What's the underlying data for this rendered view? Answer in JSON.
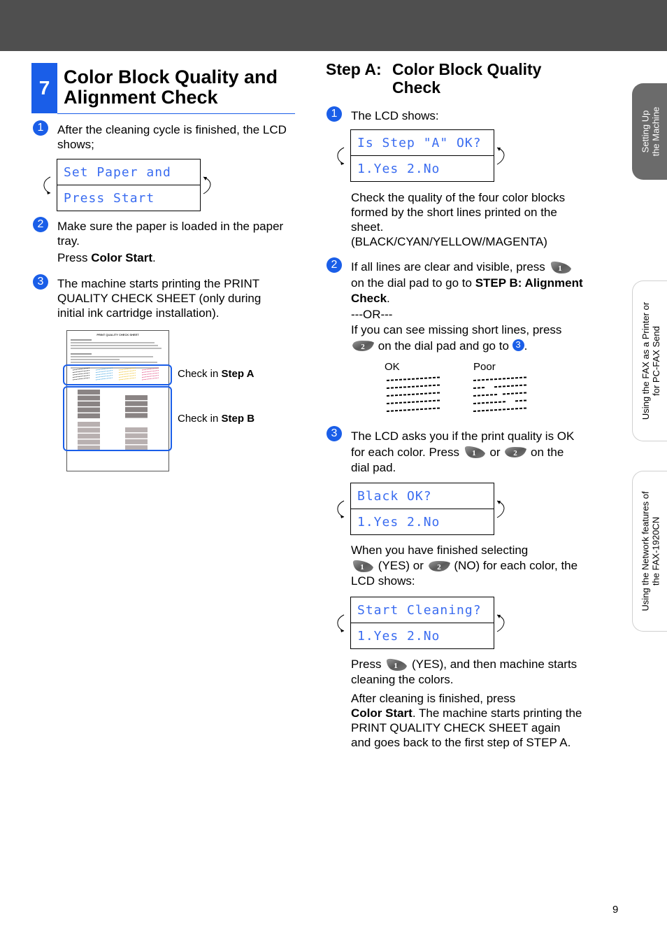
{
  "header": {
    "bar_color": "#4f4f4f"
  },
  "section": {
    "number": "7",
    "title_line1": "Color Block Quality and",
    "title_line2": "Alignment Check",
    "accent": "#1a5ee8"
  },
  "left": {
    "step1": {
      "num": "1",
      "text1": "After the cleaning cycle is finished, the LCD",
      "text2": "shows;"
    },
    "lcd1": {
      "line1": "Set Paper and",
      "line2": "Press Start"
    },
    "step2": {
      "num": "2",
      "text1": "Make sure the paper is loaded in the paper",
      "text2": "tray.",
      "press_prefix": "Press ",
      "press_bold": "Color Start",
      "press_suffix": "."
    },
    "step3": {
      "num": "3",
      "text1": "The machine starts printing the PRINT",
      "text2": "QUALITY CHECK SHEET (only during",
      "text3": "initial ink cartridge installation)."
    },
    "figure": {
      "sheet_title": "PRINT QUALITY CHECK SHEET",
      "label_a_prefix": "Check in ",
      "label_a_bold": "Step A",
      "label_b_prefix": "Check in ",
      "label_b_bold": "Step B",
      "ink_colors": [
        "#222222",
        "#3aa0e0",
        "#f0c020",
        "#e0407a"
      ]
    }
  },
  "right": {
    "heading": {
      "prefix": "Step A:",
      "title_line1": "Color Block Quality",
      "title_line2": "Check"
    },
    "step1": {
      "num": "1",
      "text": "The LCD shows:"
    },
    "lcd1": {
      "line1": "Is Step \"A\" OK?",
      "line2": "1.Yes 2.No"
    },
    "check_text": {
      "line1": "Check the quality of the four color blocks",
      "line2": "formed by the short lines printed on the",
      "line3": "sheet.",
      "line4": "(BLACK/CYAN/YELLOW/MAGENTA)"
    },
    "step2": {
      "num": "2",
      "line1": "If all lines are clear and visible, press",
      "line2_prefix": "on the dial pad to go to ",
      "line2_bold": "STEP B: Alignment",
      "line3_bold": "Check",
      "line3_suffix": ".",
      "or": "---OR---",
      "line5": "If you can see missing short lines, press",
      "line6": "on the dial pad and go to",
      "goto_num": "3"
    },
    "samples": {
      "ok_label": "OK",
      "poor_label": "Poor"
    },
    "step3": {
      "num": "3",
      "line1": "The LCD asks you if the print quality is OK",
      "line2_prefix": "for each color. Press",
      "or": "or",
      "line2_suffix": "on the",
      "line3": "dial pad."
    },
    "lcd2": {
      "line1": "Black OK?",
      "line2": "1.Yes 2.No"
    },
    "finished": {
      "line1": "When you have finished selecting",
      "yes": "(YES) or",
      "no": "(NO) for each color, the",
      "line3": "LCD shows:"
    },
    "lcd3": {
      "line1": "Start Cleaning?",
      "line2": "1.Yes 2.No"
    },
    "press": {
      "prefix": "Press",
      "suffix": "(YES), and then machine starts",
      "line2": "cleaning the colors."
    },
    "after": {
      "line1": "After cleaning is finished, press",
      "line2_bold": "Color Start",
      "line2_rest": ". The machine starts printing the",
      "line3": "PRINT QUALITY CHECK SHEET again",
      "line4": "and goes back to the first step of STEP A."
    },
    "keys": {
      "one": "1",
      "two": "2"
    }
  },
  "side_tabs": [
    {
      "line1": "Setting Up",
      "line2": "the Machine",
      "active": true
    },
    {
      "line1": "Using the FAX as a Printer or",
      "line2": "for PC-FAX Send",
      "active": false
    },
    {
      "line1": "Using the Network features of",
      "line2": "the FAX-1920CN",
      "active": false
    }
  ],
  "page_number": "9"
}
